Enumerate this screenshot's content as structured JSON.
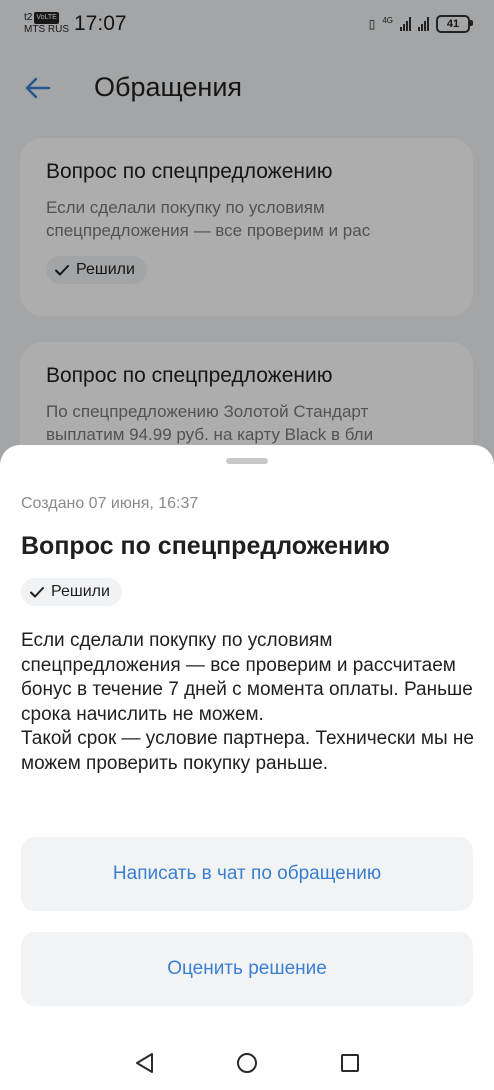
{
  "status_bar": {
    "carrier_top": "t2",
    "volte": "VoLTE",
    "carrier_bottom": "MTS RUS",
    "time": "17:07",
    "network": "4G",
    "battery": "41"
  },
  "header": {
    "title": "Обращения"
  },
  "list": [
    {
      "title": "Вопрос по спецпредложению",
      "text_line1": "Если сделали покупку по условиям",
      "text_line2": "спецпредложения — все проверим и рас",
      "status": "Решили"
    },
    {
      "title": "Вопрос по спецпредложению",
      "text_line1": "По спецпредложению Золотой Стандарт",
      "text_line2": "выплатим 94.99 руб. на карту Black в бли"
    }
  ],
  "sheet": {
    "created": "Создано 07 июня, 16:37",
    "title": "Вопрос по спецпредложению",
    "status": "Решили",
    "body": "Если сделали покупку по условиям спецпредложения — все проверим и рассчитаем бонус в течение 7 дней с момента оплаты. Раньше срока начислить не можем.\n  Такой срок — условие партнера. Технически мы не можем проверить покупку раньше.",
    "chat_button": "Написать в чат по обращению",
    "rate_button": "Оценить решение"
  },
  "colors": {
    "accent": "#3b7fd1",
    "background": "#f2f3f5",
    "overlay": "rgba(0,0,0,0.32)"
  }
}
